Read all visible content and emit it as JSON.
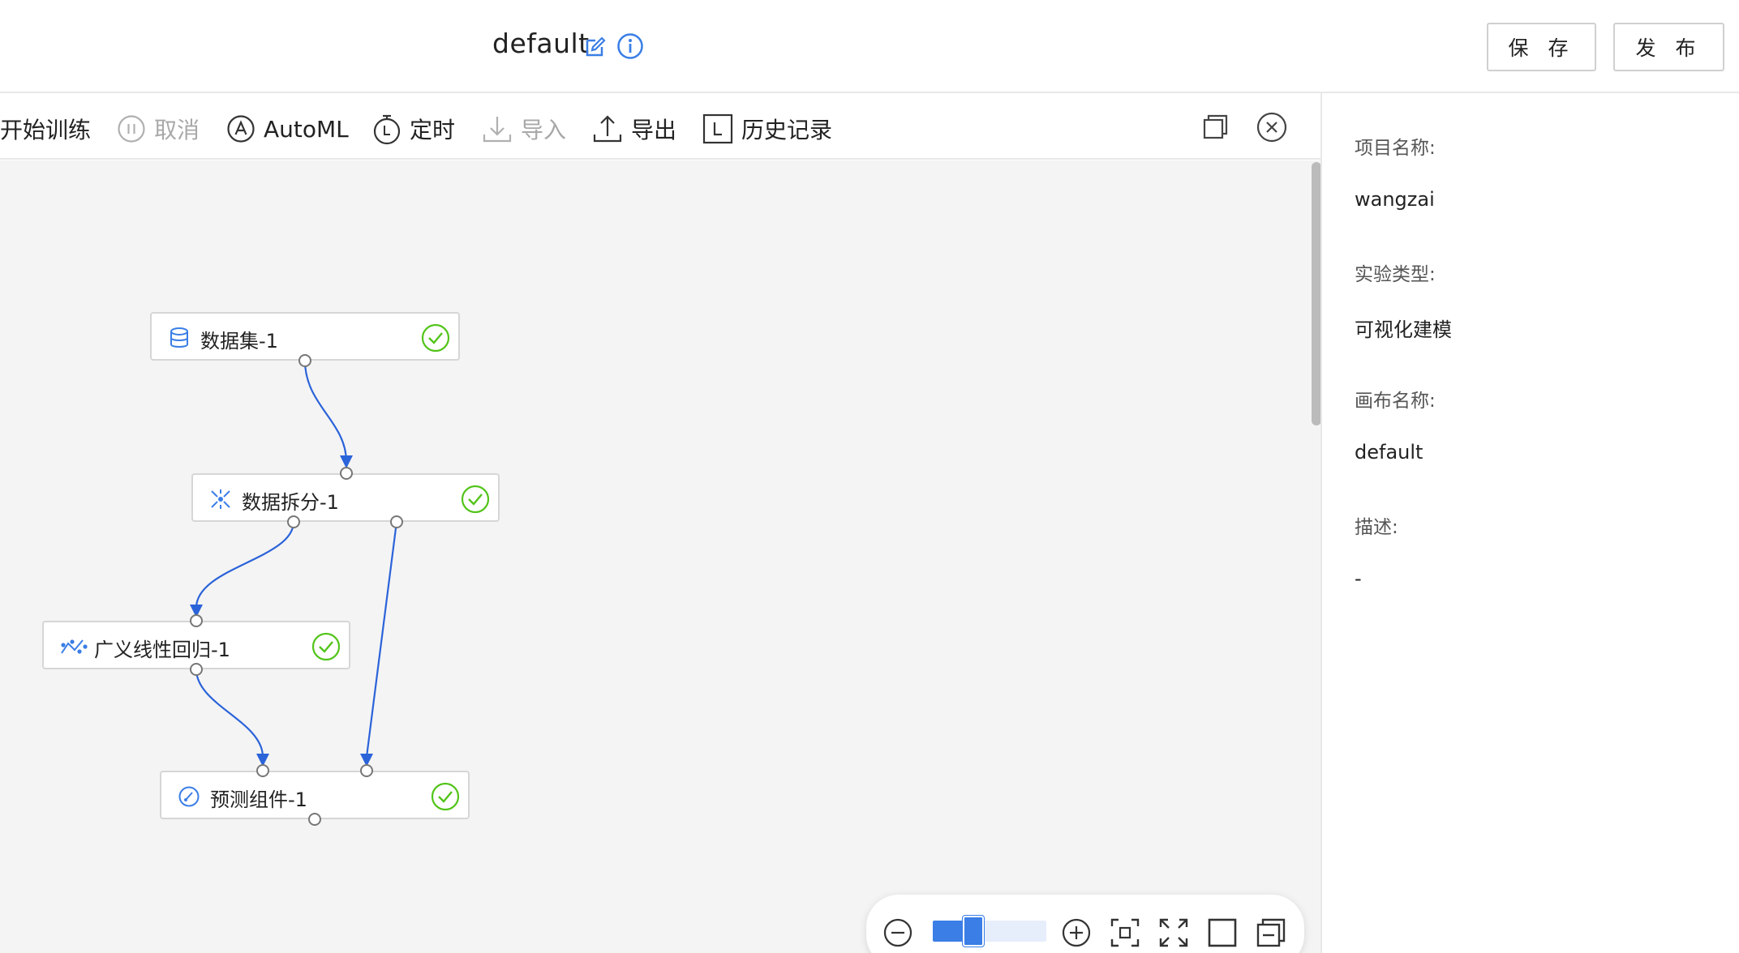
{
  "header": {
    "title": "default",
    "save_label": "保 存",
    "publish_label": "发 布"
  },
  "toolbar": {
    "start_train": "开始训练",
    "cancel": "取消",
    "automl": "AutoML",
    "schedule": "定时",
    "import": "导入",
    "export": "导出",
    "history": "历史记录"
  },
  "canvas": {
    "nodes": [
      {
        "label": "数据集-1",
        "icon": "database-icon",
        "status": "success"
      },
      {
        "label": "数据拆分-1",
        "icon": "split-icon",
        "status": "success"
      },
      {
        "label": "广义线性回归-1",
        "icon": "regression-icon",
        "status": "success"
      },
      {
        "label": "预测组件-1",
        "icon": "predict-icon",
        "status": "success"
      }
    ],
    "edges": [
      {
        "from": "数据集-1",
        "to": "数据拆分-1"
      },
      {
        "from": "数据拆分-1",
        "to": "广义线性回归-1"
      },
      {
        "from": "数据拆分-1",
        "to": "预测组件-1"
      },
      {
        "from": "广义线性回归-1",
        "to": "预测组件-1"
      }
    ]
  },
  "panel": {
    "project_name_label": "项目名称:",
    "project_name": "wangzai",
    "experiment_type_label": "实验类型:",
    "experiment_type": "可视化建模",
    "canvas_name_label": "画布名称:",
    "canvas_name": "default",
    "description_label": "描述:",
    "description": "-"
  },
  "zoom": {
    "level": 0.36
  },
  "colors": {
    "accent": "#3a7ee6",
    "success": "#52c41a",
    "edge": "#2b63d9"
  }
}
